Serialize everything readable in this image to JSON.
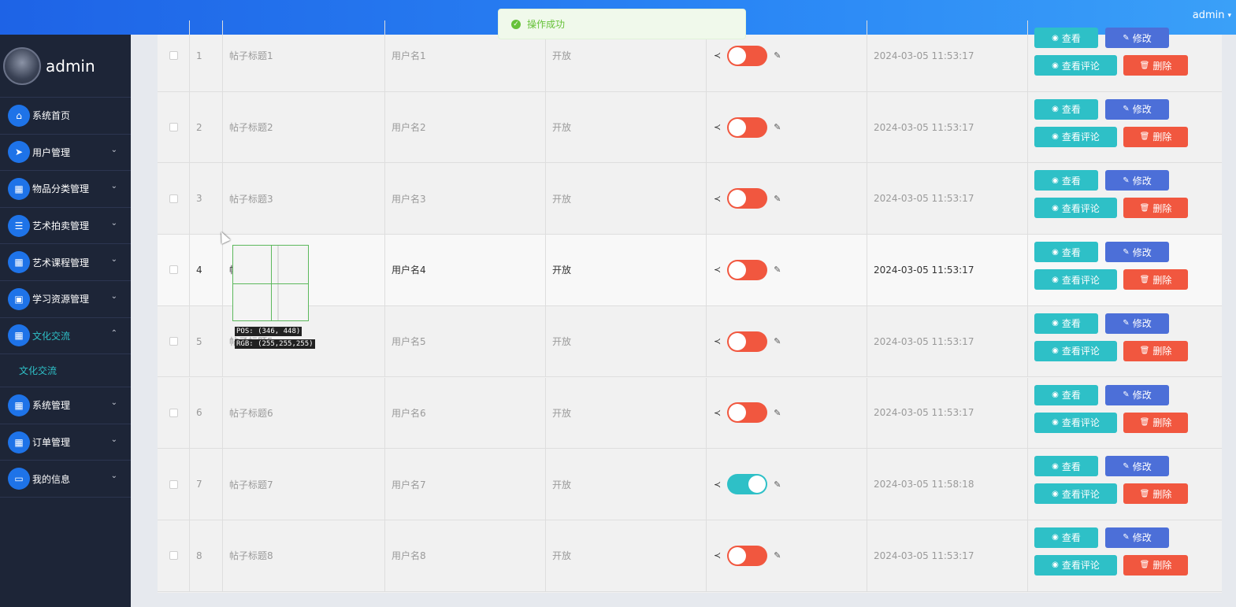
{
  "header": {
    "user_label": "admin",
    "caret": "▾"
  },
  "toast": {
    "icon": "✓",
    "message": "操作成功"
  },
  "sidebar": {
    "profile_name": "admin",
    "items": [
      {
        "label": "系统首页",
        "icon": "⌂",
        "has_arrow": false
      },
      {
        "label": "用户管理",
        "icon": "➤",
        "has_arrow": true
      },
      {
        "label": "物品分类管理",
        "icon": "▦",
        "has_arrow": true
      },
      {
        "label": "艺术拍卖管理",
        "icon": "☰",
        "has_arrow": true
      },
      {
        "label": "艺术课程管理",
        "icon": "▦",
        "has_arrow": true
      },
      {
        "label": "学习资源管理",
        "icon": "▣",
        "has_arrow": true
      },
      {
        "label": "文化交流",
        "icon": "▦",
        "has_arrow": true,
        "active": true
      },
      {
        "label": "系统管理",
        "icon": "▦",
        "has_arrow": true
      },
      {
        "label": "订单管理",
        "icon": "▦",
        "has_arrow": true
      },
      {
        "label": "我的信息",
        "icon": "▭",
        "has_arrow": true
      }
    ],
    "arrow_down": "⌄",
    "arrow_up": "⌃",
    "submenu_label": "文化交流"
  },
  "table": {
    "rows": [
      {
        "num": "1",
        "title": "帖子标题1",
        "user": "用户名1",
        "status": "开放",
        "toggle_on": false,
        "date": "2024-03-05 11:53:17"
      },
      {
        "num": "2",
        "title": "帖子标题2",
        "user": "用户名2",
        "status": "开放",
        "toggle_on": false,
        "date": "2024-03-05 11:53:17"
      },
      {
        "num": "3",
        "title": "帖子标题3",
        "user": "用户名3",
        "status": "开放",
        "toggle_on": false,
        "date": "2024-03-05 11:53:17"
      },
      {
        "num": "4",
        "title": "帖",
        "user": "用户名4",
        "status": "开放",
        "toggle_on": false,
        "date": "2024-03-05 11:53:17",
        "highlight": true
      },
      {
        "num": "5",
        "title": "帖子标题5",
        "user": "用户名5",
        "status": "开放",
        "toggle_on": false,
        "date": "2024-03-05 11:53:17"
      },
      {
        "num": "6",
        "title": "帖子标题6",
        "user": "用户名6",
        "status": "开放",
        "toggle_on": false,
        "date": "2024-03-05 11:53:17"
      },
      {
        "num": "7",
        "title": "帖子标题7",
        "user": "用户名7",
        "status": "开放",
        "toggle_on": true,
        "date": "2024-03-05 11:58:18"
      },
      {
        "num": "8",
        "title": "帖子标题8",
        "user": "用户名8",
        "status": "开放",
        "toggle_on": false,
        "date": "2024-03-05 11:53:17"
      }
    ],
    "buttons": {
      "view": "查看",
      "view_icon": "◉",
      "edit": "修改",
      "edit_icon": "✎",
      "comment": "查看评论",
      "comment_icon": "◉",
      "delete": "删除",
      "delete_icon": "🗑"
    },
    "share_icon": "≺",
    "edit_icon": "✎"
  },
  "overlay": {
    "pos_text": "POS: (346, 448)",
    "rgb_text": "RGB: (255,255,255)"
  },
  "colors": {
    "teal": "#2ec0c7",
    "blue": "#4c6fd8",
    "red": "#f1573f",
    "sidebar_bg": "#1d2537",
    "topbar": "#1e63e6"
  }
}
